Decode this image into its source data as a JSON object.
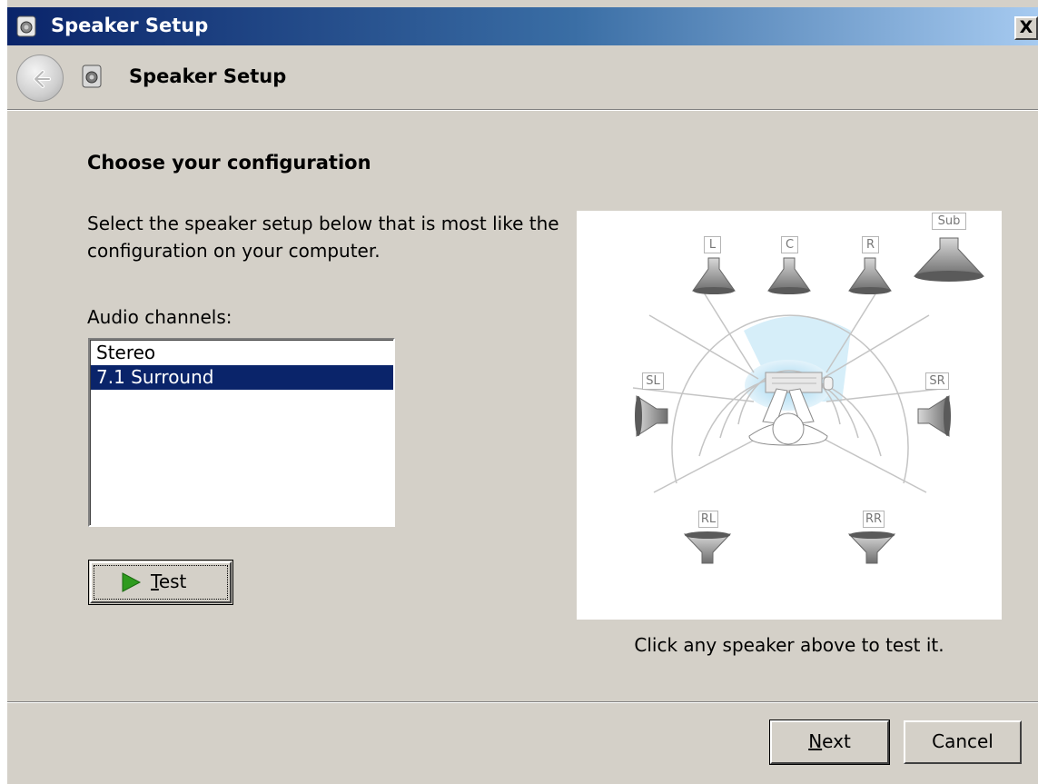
{
  "window": {
    "title": "Speaker Setup",
    "close_label": "X"
  },
  "nav": {
    "title": "Speaker Setup"
  },
  "main": {
    "heading": "Choose your configuration",
    "description": "Select the speaker setup below that is most like the configuration on your computer.",
    "channels_label": "Audio channels:",
    "channels": [
      {
        "label": "Stereo",
        "selected": false
      },
      {
        "label": "7.1 Surround",
        "selected": true
      }
    ],
    "test_button": {
      "accel": "T",
      "rest": "est"
    },
    "hint": "Click any speaker above to test it."
  },
  "speakers": {
    "sub": "Sub",
    "left": "L",
    "center": "C",
    "right": "R",
    "side_left": "SL",
    "side_right": "SR",
    "rear_left": "RL",
    "rear_right": "RR"
  },
  "footer": {
    "next_button": {
      "accel": "N",
      "rest": "ext"
    },
    "cancel_label": "Cancel"
  },
  "colors": {
    "selection": "#0a246a",
    "titlebar_start": "#0a246a",
    "titlebar_end": "#a6caf0",
    "listening_zone": "#bfe3f5"
  },
  "icons": {
    "app": "speaker-app-icon",
    "back": "back-arrow-icon",
    "test": "play-icon"
  }
}
